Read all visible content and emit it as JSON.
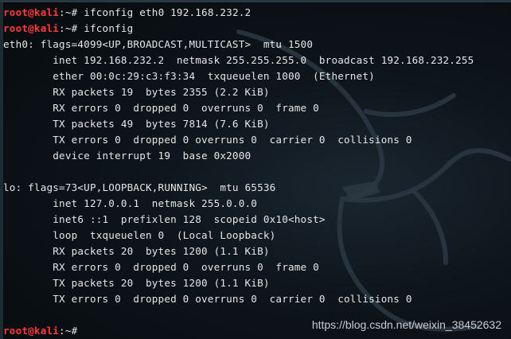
{
  "terminal": {
    "prompt_user": "root@kali",
    "prompt_path": ":~#",
    "commands": [
      " ifconfig eth0 192.168.232.2",
      " ifconfig"
    ],
    "output": [
      "eth0: flags=4099<UP,BROADCAST,MULTICAST>  mtu 1500",
      "        inet 192.168.232.2  netmask 255.255.255.0  broadcast 192.168.232.255",
      "        ether 00:0c:29:c3:f3:34  txqueuelen 1000  (Ethernet)",
      "        RX packets 19  bytes 2355 (2.2 KiB)",
      "        RX errors 0  dropped 0  overruns 0  frame 0",
      "        TX packets 49  bytes 7814 (7.6 KiB)",
      "        TX errors 0  dropped 0 overruns 0  carrier 0  collisions 0",
      "        device interrupt 19  base 0x2000",
      "",
      "lo: flags=73<UP,LOOPBACK,RUNNING>  mtu 65536",
      "        inet 127.0.0.1  netmask 255.0.0.0",
      "        inet6 ::1  prefixlen 128  scopeid 0x10<host>",
      "        loop  txqueuelen 0  (Local Loopback)",
      "        RX packets 20  bytes 1200 (1.1 KiB)",
      "        RX errors 0  dropped 0  overruns 0  frame 0",
      "        TX packets 20  bytes 1200 (1.1 KiB)",
      "        TX errors 0  dropped 0 overruns 0  carrier 0  collisions 0",
      ""
    ],
    "final_command": " "
  },
  "watermark": "https://blog.csdn.net/weixin_38452632",
  "colors": {
    "prompt_user": "#ff3b3b",
    "text": "#e6e6e6",
    "background": "#0b1014"
  }
}
